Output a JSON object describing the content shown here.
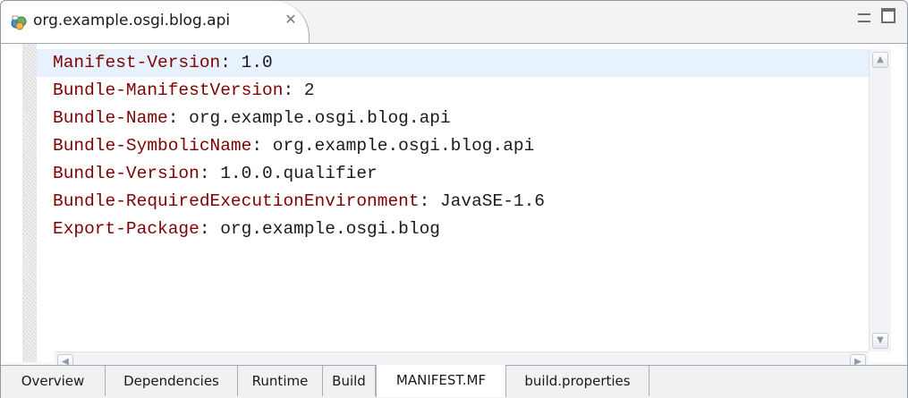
{
  "editor_tab": {
    "title": "org.example.osgi.blog.api",
    "close_glyph": "✕",
    "icon": "plugin-manifest-icon"
  },
  "window_controls": {
    "minimize_icon": "minimize-icon",
    "maximize_icon": "maximize-icon"
  },
  "manifest": {
    "lines": [
      {
        "key": "Manifest-Version",
        "value": "1.0"
      },
      {
        "key": "Bundle-ManifestVersion",
        "value": "2"
      },
      {
        "key": "Bundle-Name",
        "value": "org.example.osgi.blog.api"
      },
      {
        "key": "Bundle-SymbolicName",
        "value": "org.example.osgi.blog.api"
      },
      {
        "key": "Bundle-Version",
        "value": "1.0.0.qualifier"
      },
      {
        "key": "Bundle-RequiredExecutionEnvironment",
        "value": "JavaSE-1.6"
      },
      {
        "key": "Export-Package",
        "value": "org.example.osgi.blog"
      }
    ],
    "separator": ": "
  },
  "colors": {
    "key_color": "#7f0000",
    "value_color": "#1a1a1a",
    "current_line": "#e8f2fe"
  },
  "page_tabs": {
    "items": [
      "Overview",
      "Dependencies",
      "Runtime",
      "Build",
      "MANIFEST.MF",
      "build.properties"
    ],
    "active": "MANIFEST.MF"
  }
}
